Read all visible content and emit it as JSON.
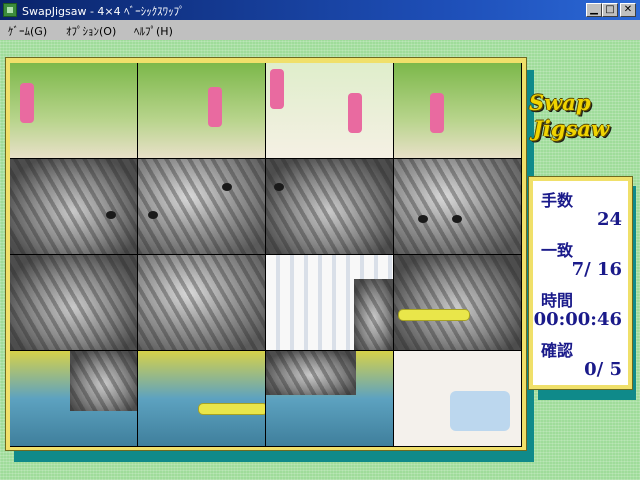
{
  "window": {
    "title": "SwapJigsaw - 4×4 ﾍﾞｰｼｯｸｽﾜｯﾌﾟ",
    "min_glyph": "▁",
    "max_glyph": "□",
    "close_glyph": "✕"
  },
  "menu": {
    "items": [
      "ｹﾞｰﾑ(G)",
      "ｵﾌﾟｼｮﾝ(O)",
      "ﾍﾙﾌﾟ(H)"
    ]
  },
  "logo": {
    "line1": "Swap",
    "line2": "Jigsaw"
  },
  "stats": {
    "moves_label": "手数",
    "moves_value": "24",
    "match_label": "一致",
    "match_value": "7/  16",
    "time_label": "時間",
    "time_value": "00:00:46",
    "check_label": "確認",
    "check_value": "0/    5"
  },
  "colors": {
    "titlebar": "#0a246a",
    "desktop_green": "#9fdc9a",
    "frame_yellow": "#f0e06a",
    "shadow_teal": "#0f8a8a",
    "stat_text": "#1a1a8a",
    "logo_yellow": "#f0d400"
  },
  "board": {
    "rows": 4,
    "cols": 4
  }
}
